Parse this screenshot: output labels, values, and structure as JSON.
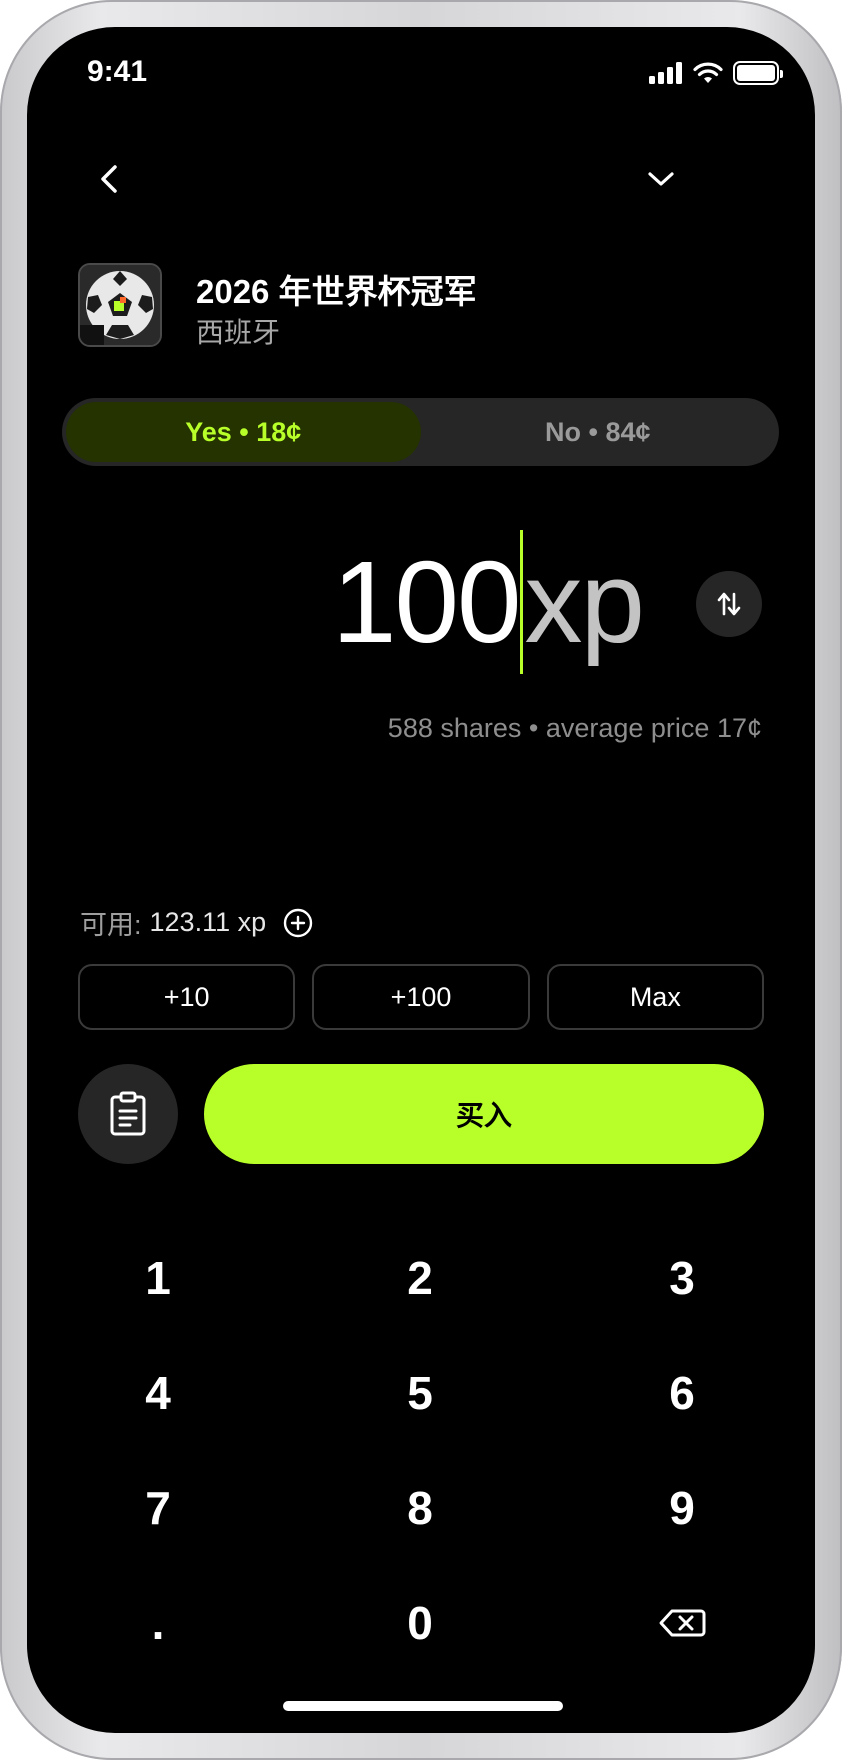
{
  "status_bar": {
    "time": "9:41"
  },
  "market": {
    "title": "2026 年世界杯冠军",
    "subtitle": "西班牙"
  },
  "outcomes": {
    "yes_label": "Yes • 18¢",
    "no_label": "No • 84¢",
    "selected": "yes"
  },
  "amount": {
    "value": "100",
    "unit": "xp"
  },
  "summary": "588 shares • average price 17¢",
  "available": {
    "label": "可用:",
    "value": "123.11 xp"
  },
  "quick_add": [
    "+10",
    "+100",
    "Max"
  ],
  "buy_label": "买入",
  "keypad": [
    "1",
    "2",
    "3",
    "4",
    "5",
    "6",
    "7",
    "8",
    "9",
    ".",
    "0"
  ],
  "colors": {
    "accent": "#b8ff2a",
    "accent_dark": "#243300",
    "background": "#000000",
    "surface": "#262626"
  },
  "icons": {
    "back": "chevron-left-icon",
    "collapse": "chevron-down-icon",
    "swap": "swap-vertical-icon",
    "add": "plus-circle-icon",
    "clipboard": "clipboard-icon",
    "backspace": "backspace-icon"
  }
}
